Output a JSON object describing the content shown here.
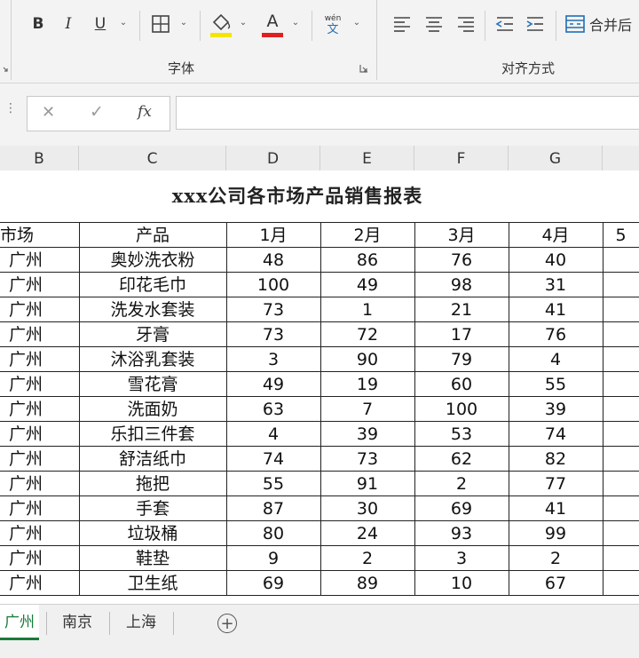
{
  "ribbon": {
    "bold_label": "B",
    "italic_label": "I",
    "underline_label": "U",
    "font_color_label": "A",
    "phonetic_top": "wén",
    "phonetic_bottom": "文",
    "merge_label": "合并后",
    "font_group_label": "字体",
    "align_group_label": "对齐方式",
    "fill_color": "#f5e400",
    "font_color": "#e02020"
  },
  "formula_bar": {
    "cancel_symbol": "✕",
    "enter_symbol": "✓",
    "fx_symbol": "fx",
    "value": ""
  },
  "columns": [
    "B",
    "C",
    "D",
    "E",
    "F",
    "G"
  ],
  "sheet": {
    "title": "xxx公司各市场产品销售报表",
    "headers": [
      "市场",
      "产品",
      "1月",
      "2月",
      "3月",
      "4月",
      "5"
    ],
    "rows": [
      {
        "market": "广州",
        "product": "奥妙洗衣粉",
        "m1": "48",
        "m2": "86",
        "m3": "76",
        "m4": "40"
      },
      {
        "market": "广州",
        "product": "印花毛巾",
        "m1": "100",
        "m2": "49",
        "m3": "98",
        "m4": "31"
      },
      {
        "market": "广州",
        "product": "洗发水套装",
        "m1": "73",
        "m2": "1",
        "m3": "21",
        "m4": "41"
      },
      {
        "market": "广州",
        "product": "牙膏",
        "m1": "73",
        "m2": "72",
        "m3": "17",
        "m4": "76"
      },
      {
        "market": "广州",
        "product": "沐浴乳套装",
        "m1": "3",
        "m2": "90",
        "m3": "79",
        "m4": "4"
      },
      {
        "market": "广州",
        "product": "雪花膏",
        "m1": "49",
        "m2": "19",
        "m3": "60",
        "m4": "55"
      },
      {
        "market": "广州",
        "product": "洗面奶",
        "m1": "63",
        "m2": "7",
        "m3": "100",
        "m4": "39"
      },
      {
        "market": "广州",
        "product": "乐扣三件套",
        "m1": "4",
        "m2": "39",
        "m3": "53",
        "m4": "74"
      },
      {
        "market": "广州",
        "product": "舒洁纸巾",
        "m1": "74",
        "m2": "73",
        "m3": "62",
        "m4": "82"
      },
      {
        "market": "广州",
        "product": "拖把",
        "m1": "55",
        "m2": "91",
        "m3": "2",
        "m4": "77"
      },
      {
        "market": "广州",
        "product": "手套",
        "m1": "87",
        "m2": "30",
        "m3": "69",
        "m4": "41"
      },
      {
        "market": "广州",
        "product": "垃圾桶",
        "m1": "80",
        "m2": "24",
        "m3": "93",
        "m4": "99"
      },
      {
        "market": "广州",
        "product": "鞋垫",
        "m1": "9",
        "m2": "2",
        "m3": "3",
        "m4": "2"
      },
      {
        "market": "广州",
        "product": "卫生纸",
        "m1": "69",
        "m2": "89",
        "m3": "10",
        "m4": "67"
      }
    ]
  },
  "tabs": [
    "广州",
    "南京",
    "上海"
  ],
  "add_sheet_symbol": "+"
}
